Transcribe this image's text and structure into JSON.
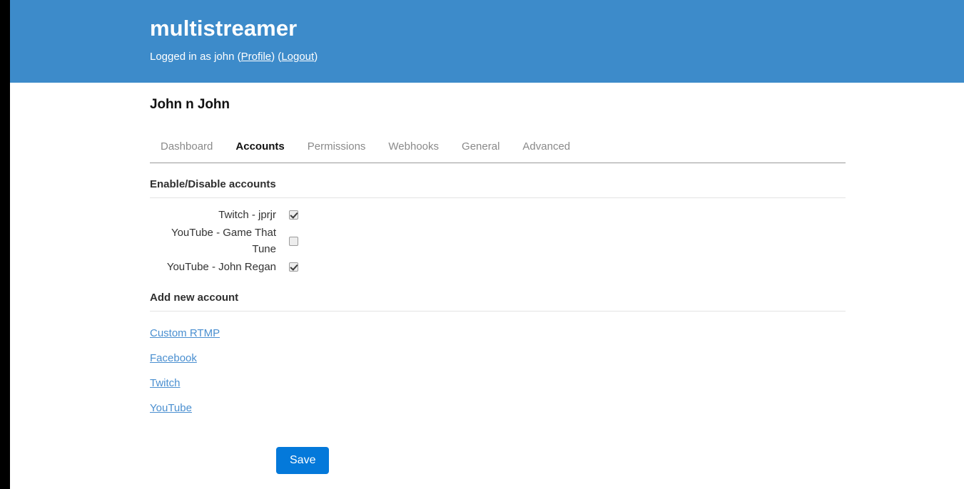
{
  "app": {
    "title": "multistreamer",
    "header_bg": "#3d8bca",
    "link_color": "#4a8fd0",
    "button_color": "#0479da"
  },
  "session": {
    "prefix": "Logged in as john (",
    "profile_label": "Profile",
    "middle": ") (",
    "logout_label": "Logout",
    "suffix": ")"
  },
  "stream": {
    "title": "John n John"
  },
  "tabs": [
    {
      "label": "Dashboard",
      "active": false
    },
    {
      "label": "Accounts",
      "active": true
    },
    {
      "label": "Permissions",
      "active": false
    },
    {
      "label": "Webhooks",
      "active": false
    },
    {
      "label": "General",
      "active": false
    },
    {
      "label": "Advanced",
      "active": false
    }
  ],
  "enable_section": {
    "heading": "Enable/Disable accounts",
    "accounts": [
      {
        "label": "Twitch - jprjr",
        "checked": true
      },
      {
        "label": "YouTube - Game That Tune",
        "checked": false
      },
      {
        "label": "YouTube - John Regan",
        "checked": true
      }
    ]
  },
  "add_section": {
    "heading": "Add new account",
    "links": [
      {
        "label": "Custom RTMP"
      },
      {
        "label": "Facebook"
      },
      {
        "label": "Twitch"
      },
      {
        "label": "YouTube"
      }
    ]
  },
  "form": {
    "save_label": "Save"
  }
}
